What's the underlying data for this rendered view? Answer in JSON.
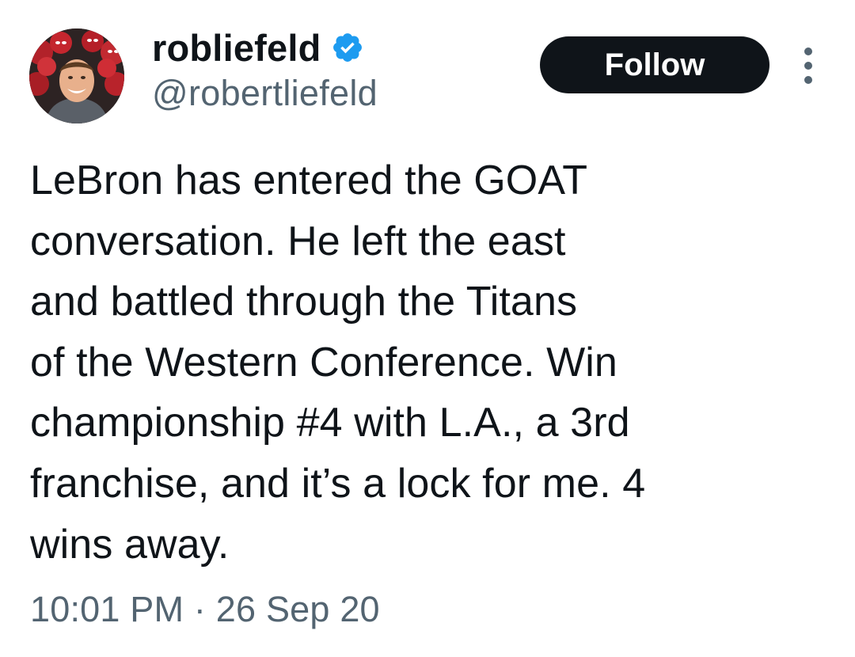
{
  "author": {
    "display_name": "robliefeld",
    "handle": "@robertliefeld",
    "verified_icon": "verified-badge-icon",
    "avatar_icon": "profile-photo"
  },
  "follow_button": {
    "label": "Follow"
  },
  "more_menu": {
    "icon": "more-vertical-icon"
  },
  "tweet": {
    "text_lines": [
      "LeBron has entered the GOAT",
      "conversation. He left the east",
      "and battled through the Titans",
      "of the Western Conference. Win",
      "championship #4 with L.A., a 3rd",
      "franchise, and it’s a lock for me. 4",
      "wins away."
    ],
    "timestamp": "10:01 PM · 26 Sep 20"
  },
  "colors": {
    "text_primary": "#0f1419",
    "text_secondary": "#536471",
    "verified_blue": "#1d9bf0",
    "button_bg": "#0f1419",
    "button_text": "#ffffff"
  }
}
